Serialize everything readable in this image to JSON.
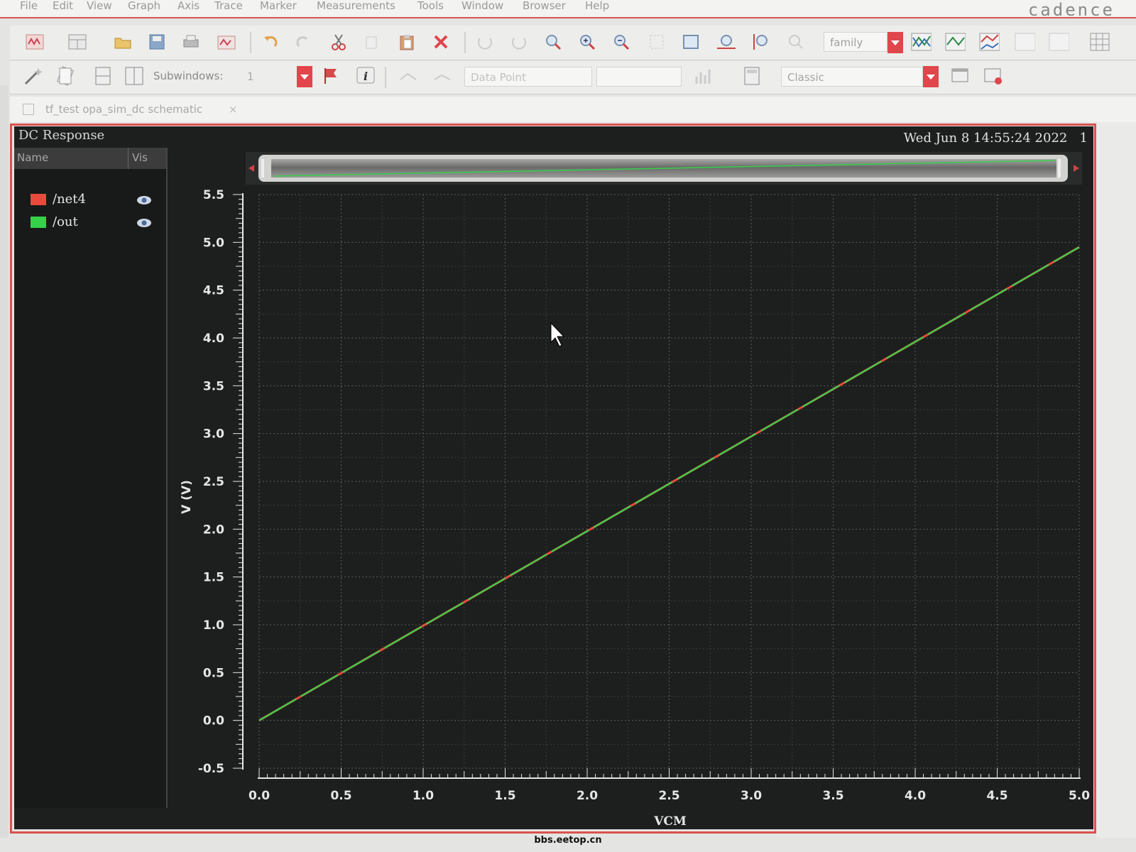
{
  "menu": [
    "File",
    "Edit",
    "View",
    "Graph",
    "Axis",
    "Trace",
    "Marker",
    "Measurements",
    "Tools",
    "Window",
    "Browser",
    "Help"
  ],
  "brand": "cadence",
  "toolbar1": {
    "family_field": "family"
  },
  "toolbar2": {
    "subwindows_label": "Subwindows:",
    "subwindows_value": "1",
    "datapoint_field": "Data Point",
    "style_field": "Classic"
  },
  "tab": {
    "title": "tf_test opa_sim_dc schematic",
    "close": "×"
  },
  "window": {
    "title": "DC Response",
    "datetime": "Wed Jun 8 14:55:24 2022",
    "index": "1"
  },
  "legend": {
    "col_name": "Name",
    "col_vis": "Vis",
    "items": [
      {
        "name": "/net4",
        "color": "#e84b3c"
      },
      {
        "name": "/out",
        "color": "#35d14a"
      }
    ]
  },
  "footer": "bbs.eetop.cn",
  "chart_data": {
    "type": "line",
    "xlabel": "VCM",
    "ylabel": "V (V)",
    "xlim": [
      0.0,
      5.0
    ],
    "ylim": [
      -0.5,
      5.5
    ],
    "xticks": [
      "0.0",
      "0.5",
      "1.0",
      "1.5",
      "2.0",
      "2.5",
      "3.0",
      "3.5",
      "4.0",
      "4.5",
      "5.0"
    ],
    "yticks": [
      "-0.5",
      "0.0",
      "0.5",
      "1.0",
      "1.5",
      "2.0",
      "2.5",
      "3.0",
      "3.5",
      "4.0",
      "4.5",
      "5.0",
      "5.5"
    ],
    "grid": true,
    "legend_position": "left-panel",
    "series": [
      {
        "name": "/net4",
        "color": "#e84b3c",
        "x": [
          0.0,
          5.0
        ],
        "y": [
          0.0,
          4.95
        ]
      },
      {
        "name": "/out",
        "color": "#35d14a",
        "x": [
          0.0,
          5.0
        ],
        "y": [
          0.0,
          4.95
        ]
      }
    ]
  }
}
